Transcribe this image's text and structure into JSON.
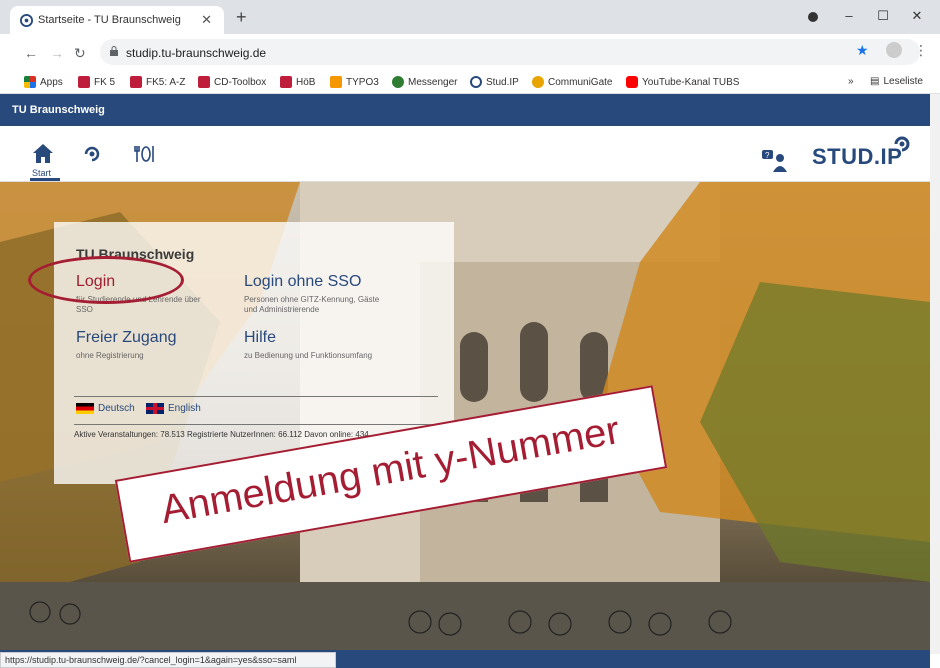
{
  "browser": {
    "tab_title": "Startseite - TU Braunschweig",
    "url": "studip.tu-braunschweig.de",
    "bookmarks": [
      {
        "label": "Apps",
        "icon": "apps-grid-icon",
        "color": "#d93025"
      },
      {
        "label": "FK 5",
        "icon": "tu-logo-icon",
        "color": "#be1e3c"
      },
      {
        "label": "FK5: A-Z",
        "icon": "tu-logo-icon",
        "color": "#be1e3c"
      },
      {
        "label": "CD-Toolbox",
        "icon": "tu-logo-icon",
        "color": "#be1e3c"
      },
      {
        "label": "HöB",
        "icon": "tu-logo-icon",
        "color": "#be1e3c"
      },
      {
        "label": "TYPO3",
        "icon": "typo3-icon",
        "color": "#f49700"
      },
      {
        "label": "Messenger",
        "icon": "messenger-icon",
        "color": "#2e7d32"
      },
      {
        "label": "Stud.IP",
        "icon": "studip-icon",
        "color": "#28497c"
      },
      {
        "label": "CommuniGate",
        "icon": "communigate-icon",
        "color": "#e8a400"
      },
      {
        "label": "YouTube-Kanal TUBS",
        "icon": "youtube-icon",
        "color": "#ff0000"
      }
    ],
    "reading_list": "Leseliste",
    "status_url": "https://studip.tu-braunschweig.de/?cancel_login=1&again=yes&sso=saml"
  },
  "app": {
    "header": "TU Braunschweig",
    "nav_start": "Start",
    "logo": "STUD.IP"
  },
  "login_panel": {
    "title": "TU Braunschweig",
    "login": {
      "label": "Login",
      "sub": "für Studierende und Lehrende über SSO"
    },
    "login_no_sso": {
      "label": "Login ohne SSO",
      "sub": "Personen ohne GITZ-Kennung, Gäste und Administrierende"
    },
    "free_access": {
      "label": "Freier Zugang",
      "sub": "ohne Registrierung"
    },
    "help": {
      "label": "Hilfe",
      "sub": "zu Bedienung und Funktionsumfang"
    },
    "lang_de": "Deutsch",
    "lang_en": "English",
    "stats": "Aktive Veranstaltungen: 78.513   Registrierte NutzerInnen: 66.112   Davon online: 434"
  },
  "annotation": {
    "banner_text": "Anmeldung mit y-Nummer",
    "color": "#a51d32"
  }
}
